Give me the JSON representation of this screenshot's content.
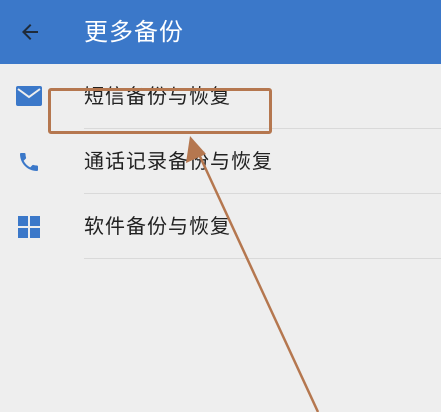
{
  "header": {
    "title": "更多备份",
    "back_icon": "arrow-left-icon"
  },
  "menu": {
    "items": [
      {
        "label": "短信备份与恢复",
        "icon": "envelope-icon"
      },
      {
        "label": "通话记录备份与恢复",
        "icon": "phone-icon"
      },
      {
        "label": "软件备份与恢复",
        "icon": "grid-icon"
      }
    ]
  },
  "colors": {
    "app_bar": "#3b78c9",
    "icon": "#3b78c9",
    "annotation": "#b5774f",
    "background": "#eeeeee"
  }
}
